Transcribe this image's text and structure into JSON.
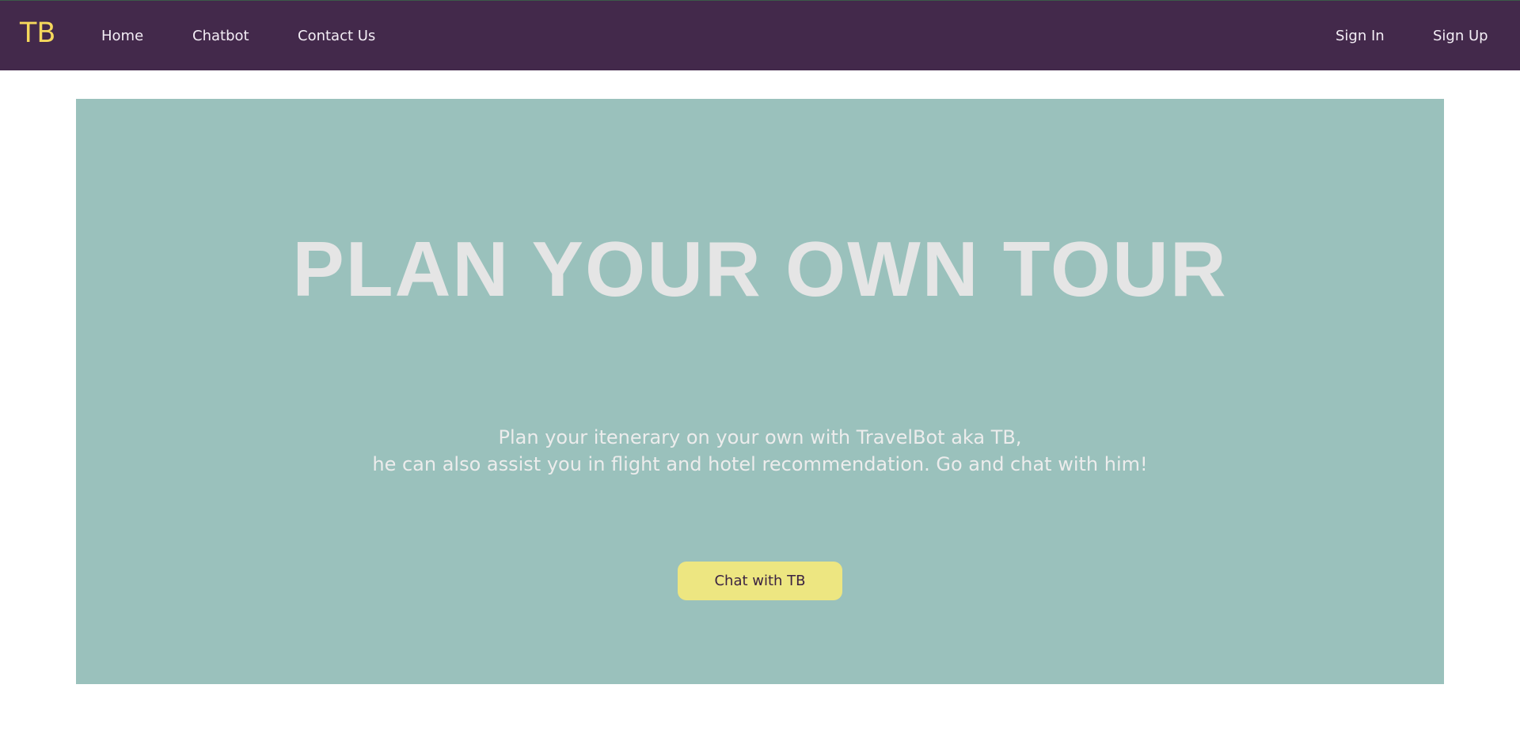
{
  "navbar": {
    "brand": "TB",
    "links": [
      {
        "label": "Home"
      },
      {
        "label": "Chatbot"
      },
      {
        "label": "Contact Us"
      }
    ],
    "auth": {
      "sign_in": "Sign In",
      "sign_up": "Sign Up"
    }
  },
  "hero": {
    "title": "PLAN YOUR OWN TOUR",
    "subtitle_line1": "Plan your itenerary on your own with TravelBot aka TB,",
    "subtitle_line2": "he can also assist you in flight and hotel recommendation. Go and chat with him!",
    "cta_label": "Chat with TB"
  },
  "colors": {
    "navbar_bg": "#43294b",
    "brand": "#f5d85c",
    "hero_bg": "#9ac1bc",
    "hero_text": "#e5e5e5",
    "cta_bg": "#ede681",
    "cta_text": "#3b2342"
  }
}
